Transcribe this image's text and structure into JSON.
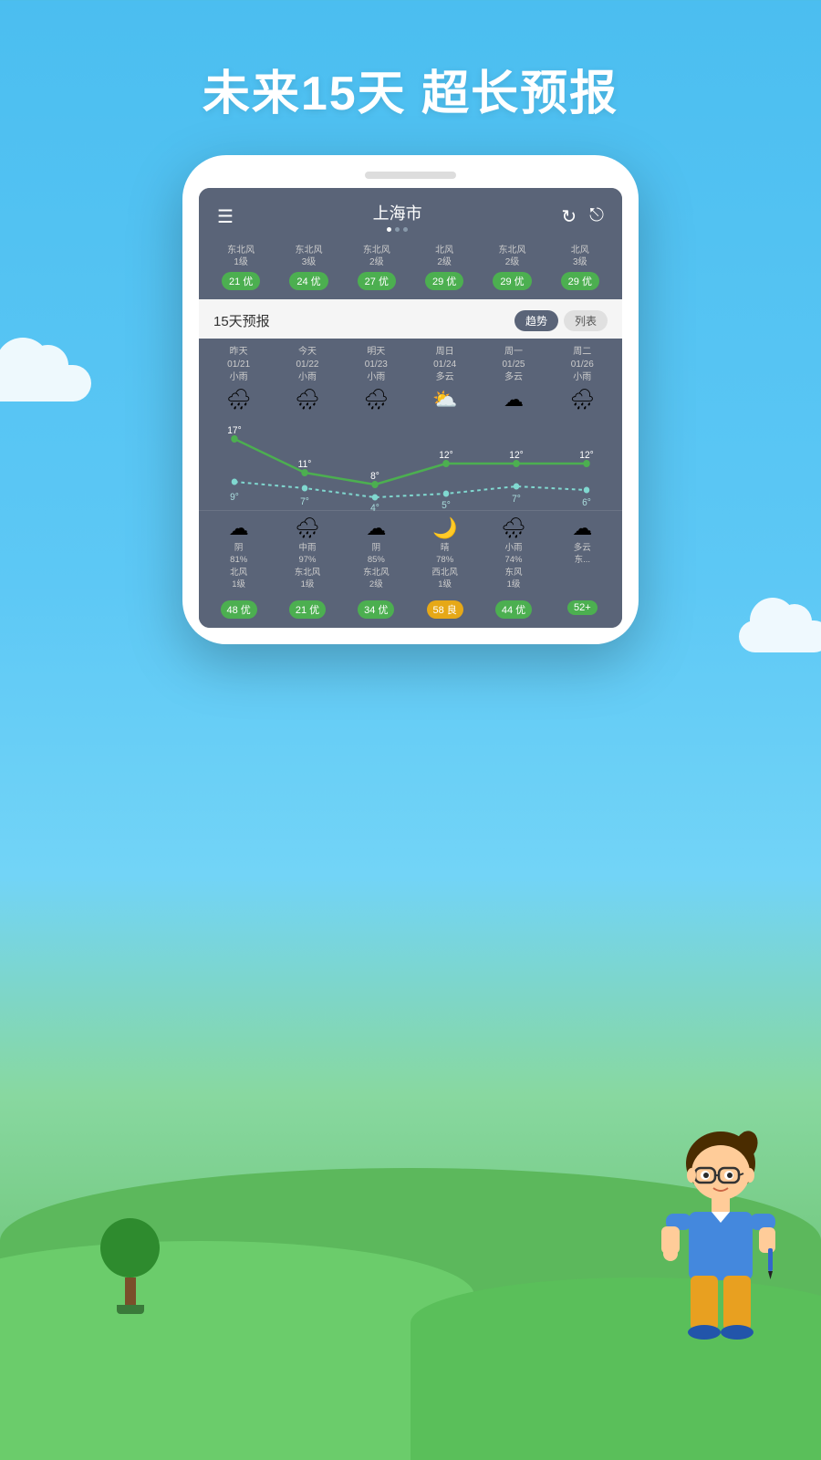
{
  "title": "未来15天 超长预报",
  "header": {
    "city": "上海市",
    "menu_icon": "☰",
    "crown_icon": "♛",
    "refresh_icon": "↻",
    "share_icon": "⎋"
  },
  "aqi_top_row": [
    {
      "wind": "东北风\n1级",
      "aqi": "21 优",
      "type": "green"
    },
    {
      "wind": "东北风\n3级",
      "aqi": "24 优",
      "type": "green"
    },
    {
      "wind": "东北风\n2级",
      "aqi": "27 优",
      "type": "green"
    },
    {
      "wind": "北风\n2级",
      "aqi": "29 优",
      "type": "green"
    },
    {
      "wind": "东北风\n2级",
      "aqi": "29 优",
      "type": "green"
    },
    {
      "wind": "北风\n3级",
      "aqi": "29 优",
      "type": "green"
    }
  ],
  "forecast_section": {
    "title": "15天预报",
    "tab_trend": "趋势",
    "tab_list": "列表"
  },
  "forecast_days": [
    {
      "label": "昨天\n01/21",
      "weather": "小雨",
      "icon": "🌧",
      "high": "17°",
      "low": "9°"
    },
    {
      "label": "今天\n01/22",
      "weather": "小雨",
      "icon": "🌧",
      "high": "11°",
      "low": "7°"
    },
    {
      "label": "明天\n01/23",
      "weather": "小雨",
      "icon": "🌧",
      "high": "8°",
      "low": "4°"
    },
    {
      "label": "周日\n01/24",
      "weather": "多云",
      "icon": "⛅",
      "high": "12°",
      "low": "5°"
    },
    {
      "label": "周一\n01/25",
      "weather": "多云",
      "icon": "☁",
      "high": "12°",
      "low": "7°"
    },
    {
      "label": "周二\n01/26",
      "weather": "小雨",
      "icon": "🌧",
      "high": "12°",
      "low": "6°"
    }
  ],
  "night_forecast": [
    {
      "icon": "☁",
      "desc": "阴\n81%\n北风\n1级"
    },
    {
      "icon": "🌧",
      "desc": "中雨\n97%\n东北风\n1级"
    },
    {
      "icon": "☁",
      "desc": "阴\n85%\n东北风\n2级"
    },
    {
      "icon": "🌙",
      "desc": "晴\n78%\n西北风\n1级"
    },
    {
      "icon": "🌧",
      "desc": "小雨\n74%\n东风\n1级"
    },
    {
      "icon": "☁",
      "desc": "多云\n东..."
    }
  ],
  "bottom_aqi": [
    {
      "aqi": "48 优",
      "type": "green"
    },
    {
      "aqi": "21 优",
      "type": "green"
    },
    {
      "aqi": "34 优",
      "type": "green"
    },
    {
      "aqi": "58 良",
      "type": "yellow"
    },
    {
      "aqi": "44 优",
      "type": "green"
    },
    {
      "aqi": "52+",
      "type": "green"
    }
  ],
  "colors": {
    "sky_top": "#4BBEF0",
    "sky_bottom": "#72D4F7",
    "hill": "#5CB85C",
    "phone_bg": "#5a6478",
    "green_badge": "#4CAF50",
    "yellow_badge": "#E6A817"
  }
}
